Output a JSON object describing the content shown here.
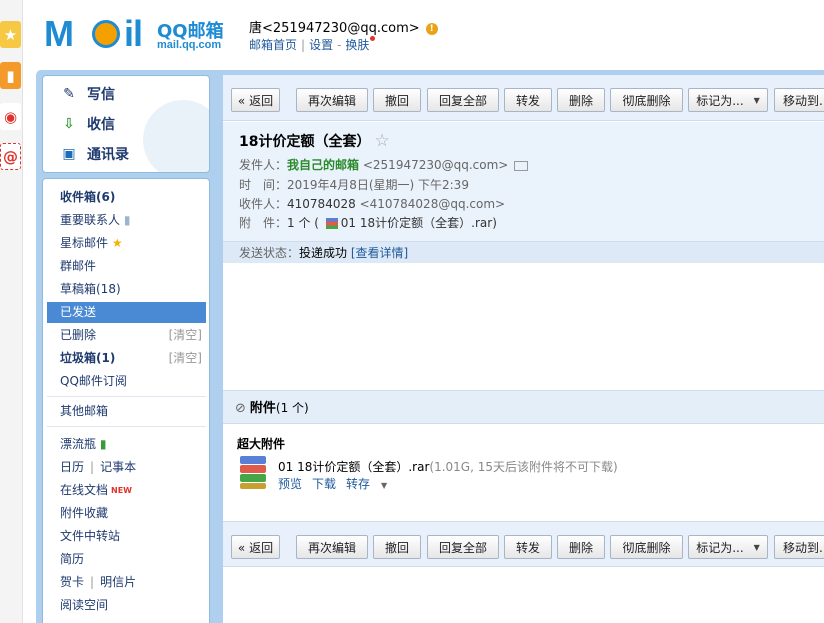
{
  "header": {
    "logo_text_m": "M",
    "logo_text_il": "il",
    "logo_qq": "QQ邮箱",
    "logo_domain": "mail.qq.com",
    "user": "唐<251947230@qq.com>",
    "warn_glyph": "!",
    "links": [
      "邮箱首页",
      "设置",
      "换肤"
    ]
  },
  "nav_top": {
    "compose": "写信",
    "receive": "收信",
    "contacts": "通讯录"
  },
  "nav": {
    "inbox": "收件箱(6)",
    "vip": "重要联系人",
    "starred": "星标邮件",
    "groups": "群邮件",
    "drafts": "草稿箱(18)",
    "sent": "已发送",
    "deleted": "已删除",
    "deleted_action": "[清空]",
    "spam": "垃圾箱(1)",
    "spam_action": "[清空]",
    "subscriptions": "QQ邮件订阅",
    "other_mailbox": "其他邮箱",
    "drift_bottle": "漂流瓶",
    "calendar": "日历",
    "notes": "记事本",
    "docs": "在线文档",
    "docs_badge": "NEW",
    "attachments": "附件收藏",
    "file_transfer": "文件中转站",
    "resume": "简历",
    "cards": "贺卡",
    "postcards": "明信片",
    "reading": "阅读空间"
  },
  "toolbar": {
    "back": "« 返回",
    "reedit": "再次编辑",
    "recall": "撤回",
    "reply_all": "回复全部",
    "forward": "转发",
    "delete": "删除",
    "delete_perm": "彻底删除",
    "mark_as": "标记为...",
    "move_to": "移动到..."
  },
  "mail": {
    "subject": "18计价定额（全套）",
    "star_glyph": "☆",
    "from_label": "发件人：",
    "from_name": "我自己的邮箱",
    "from_addr": "<251947230@qq.com>",
    "time_label": "时　间：",
    "time_value": "2019年4月8日(星期一) 下午2:39",
    "to_label": "收件人：",
    "to_name": "410784028",
    "to_addr": "<410784028@qq.com>",
    "attach_label": "附　件：",
    "attach_count": "1 个 (",
    "attach_name": "01 18计价定额（全套）.rar",
    "attach_close": ")",
    "status_label": "发送状态：",
    "status_value": "投递成功",
    "status_link": "[查看详情]"
  },
  "attachments": {
    "title": "附件",
    "count": "(1 个)",
    "big_label": "超大附件",
    "file_name": "01 18计价定额（全套）.rar",
    "file_info": "(1.01G, 15天后该附件将不可下载)",
    "preview": "预览",
    "download": "下载",
    "save": "转存"
  }
}
